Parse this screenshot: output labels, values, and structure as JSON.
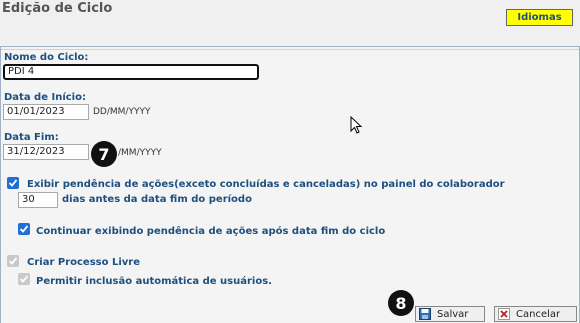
{
  "header": {
    "title": "Edição de Ciclo",
    "languages_label": "Idiomas"
  },
  "form": {
    "name_label": "Nome do Ciclo:",
    "name_value": "PDI 4",
    "start_label": "Data de Início:",
    "start_value": "01/01/2023",
    "start_hint": "DD/MM/YYYY",
    "end_label": "Data Fim:",
    "end_value": "31/12/2023",
    "end_hint": "/MM/YYYY",
    "pending_label": "Exibir pendência de ações(exceto concluídas e canceladas) no painel do colaborador",
    "pending_checked": true,
    "days_value": "30",
    "days_label": "dias antes da data fim do período",
    "continue_label": "Continuar exibindo pendência de ações após data fim do ciclo",
    "continue_checked": true,
    "free_process_label": "Criar Processo Livre",
    "free_process_checked": true,
    "auto_include_label": "Permitir inclusão automática de usuários.",
    "auto_include_checked": true
  },
  "badges": {
    "step7": "7",
    "step8": "8"
  },
  "buttons": {
    "save": "Salvar",
    "cancel": "Cancelar"
  },
  "colors": {
    "accent": "#1f6fd6",
    "label": "#1d4f7f",
    "language_button": "#ffff00"
  },
  "icons": {
    "save": "floppy-disk-icon",
    "cancel": "close-x-icon",
    "check": "checkmark-icon"
  }
}
